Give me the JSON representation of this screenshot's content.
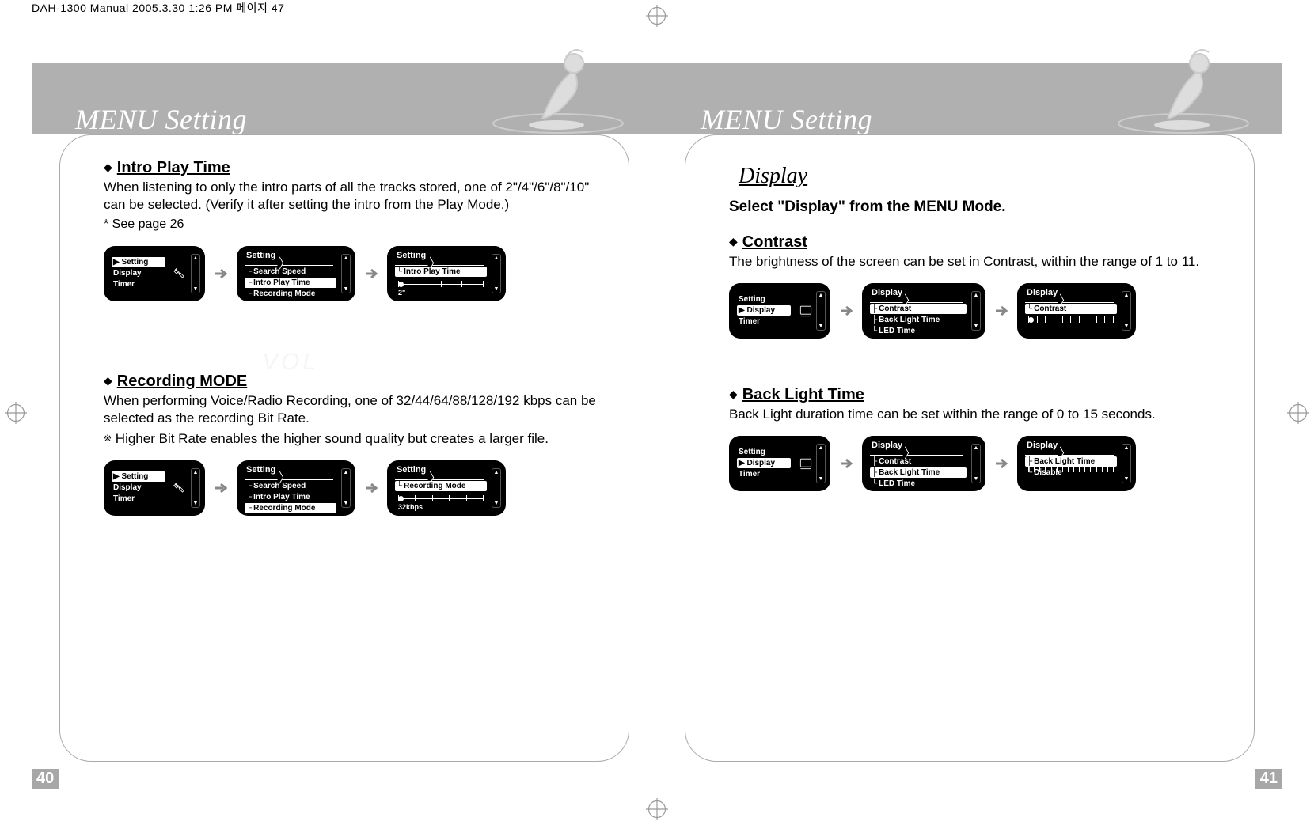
{
  "meta": {
    "header_line": "DAH-1300 Manual  2005.3.30 1:26 PM  페이지 47"
  },
  "left": {
    "page_number": "40",
    "page_title": "MENU Setting",
    "vol_ghost": "VOL",
    "sections": {
      "intro": {
        "title": "Intro Play Time",
        "body": "When listening to only the intro parts of all the tracks stored, one of 2\"/4\"/6\"/8\"/10\" can be selected. (Verify it after setting the intro from the Play Mode.)",
        "note": "* See page 26",
        "screens": {
          "s1": {
            "tab": "",
            "items": [
              "▶ Setting",
              "Display",
              "Timer"
            ],
            "selected_index": 0,
            "show_icon": true
          },
          "s2": {
            "tab": "Setting",
            "items": [
              "Search Speed",
              "Intro Play Time",
              "Recording Mode"
            ],
            "selected_index": 1
          },
          "s3": {
            "tab": "Setting",
            "item": "Intro Play Time",
            "slider_label": "2\""
          }
        }
      },
      "recmode": {
        "title": "Recording MODE",
        "body": "When performing Voice/Radio Recording, one of 32/44/64/88/128/192 kbps can be selected as the recording Bit Rate.",
        "tip_marker": "※",
        "tip": "Higher Bit Rate enables the higher sound quality but creates a larger file.",
        "screens": {
          "s1": {
            "items": [
              "▶ Setting",
              "Display",
              "Timer"
            ],
            "selected_index": 0,
            "show_icon": true
          },
          "s2": {
            "tab": "Setting",
            "items": [
              "Search Speed",
              "Intro Play Time",
              "Recording Mode"
            ],
            "selected_index": 2
          },
          "s3": {
            "tab": "Setting",
            "item": "Recording Mode",
            "slider_label": "32kbps"
          }
        }
      }
    }
  },
  "right": {
    "page_number": "41",
    "page_title": "MENU Setting",
    "subtitle": "Display",
    "instruction": "Select \"Display\" from the MENU Mode.",
    "sections": {
      "contrast": {
        "title": "Contrast",
        "body": "The brightness of the screen can be set in Contrast, within the range of 1 to 11.",
        "screens": {
          "s1": {
            "items": [
              "Setting",
              "▶ Display",
              "Timer"
            ],
            "selected_index": 1,
            "show_icon": true
          },
          "s2": {
            "tab": "Display",
            "items": [
              "Contrast",
              "Back Light Time",
              "LED Time"
            ],
            "selected_index": 0
          },
          "s3": {
            "tab": "Display",
            "item": "Contrast"
          }
        }
      },
      "backlight": {
        "title": "Back Light Time",
        "body": "Back Light duration time can be set within the range of 0 to 15 seconds.",
        "screens": {
          "s1": {
            "items": [
              "Setting",
              "▶ Display",
              "Timer"
            ],
            "selected_index": 1,
            "show_icon": true
          },
          "s2": {
            "tab": "Display",
            "items": [
              "Contrast",
              "Back Light Time",
              "LED Time"
            ],
            "selected_index": 1
          },
          "s3": {
            "tab": "Display",
            "items_vert": [
              "Back Light Time",
              "Disable"
            ],
            "selected_index": 0
          }
        }
      }
    }
  }
}
